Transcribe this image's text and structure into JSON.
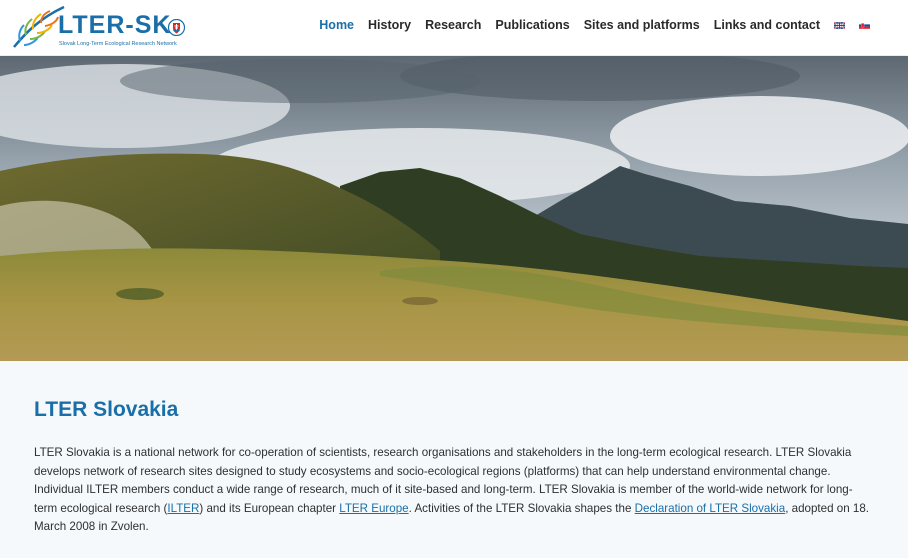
{
  "header": {
    "logo": {
      "title": "LTER-SK",
      "subtitle": "Slovak Long-Term Ecological Research Network",
      "icon": "leaf-logo-icon"
    },
    "nav": [
      {
        "label": "Home",
        "active": true
      },
      {
        "label": "History",
        "active": false
      },
      {
        "label": "Research",
        "active": false
      },
      {
        "label": "Publications",
        "active": false
      },
      {
        "label": "Sites and platforms",
        "active": false
      },
      {
        "label": "Links and contact",
        "active": false
      }
    ],
    "languages": [
      {
        "icon": "uk-flag-icon"
      },
      {
        "icon": "slovak-flag-icon"
      }
    ]
  },
  "hero": {
    "icon": "mountain-landscape-photo"
  },
  "content": {
    "title": "LTER Slovakia",
    "para": {
      "text1": "LTER Slovakia is a national network for co-operation of scientists, research organisations and stakeholders in the long-term ecological research. LTER Slovakia develops network of research sites designed to study ecosystems and socio-ecological regions (platforms) that can help understand environmental change. Individual ILTER members conduct a wide range of research, much of it site-based and long-term. LTER Slovakia is member of the world-wide network for long-term ecological research (",
      "link1": "ILTER",
      "text2": ") and its European chapter ",
      "link2": "LTER Europe",
      "text3": ". Activities of the LTER Slovakia shapes the ",
      "link3": "Declaration of LTER Slovakia",
      "text4": ", adopted on 18. March 2008 in Zvolen."
    }
  },
  "colors": {
    "brand": "#1a6fa8",
    "nav_text": "#2a2a2a",
    "body_text": "#2f2f2f",
    "page_bg": "#f5f9fc"
  }
}
